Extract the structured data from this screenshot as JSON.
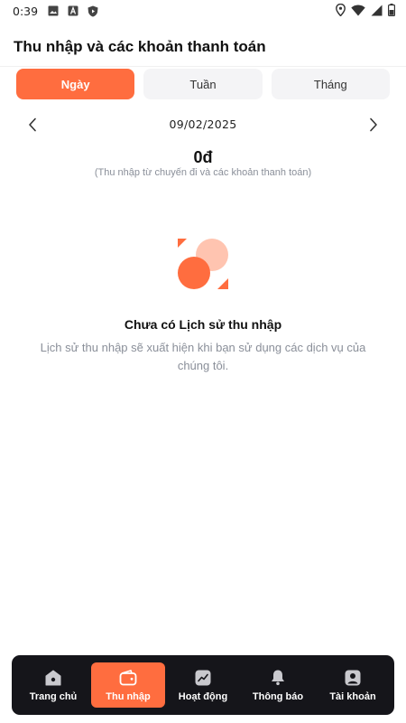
{
  "status_bar": {
    "time": "0:39"
  },
  "header": {
    "title": "Thu nhập và các khoản thanh toán"
  },
  "tabs": [
    {
      "label": "Ngày",
      "active": true
    },
    {
      "label": "Tuần",
      "active": false
    },
    {
      "label": "Tháng",
      "active": false
    }
  ],
  "date_nav": {
    "date": "09/02/2025"
  },
  "summary": {
    "amount": "0đ",
    "subtitle": "(Thu nhập từ chuyến đi và các khoản thanh toán)"
  },
  "empty_state": {
    "title": "Chưa có Lịch sử thu nhập",
    "description": "Lịch sử thu nhập sẽ xuất hiện khi bạn sử dụng các dịch vụ của chúng tôi."
  },
  "bottom_nav": {
    "items": [
      {
        "label": "Trang chủ",
        "icon": "home-icon",
        "active": false
      },
      {
        "label": "Thu nhập",
        "icon": "wallet-icon",
        "active": true
      },
      {
        "label": "Hoạt động",
        "icon": "activity-chart-icon",
        "active": false
      },
      {
        "label": "Thông báo",
        "icon": "bell-icon",
        "active": false
      },
      {
        "label": "Tài khoản",
        "icon": "account-icon",
        "active": false
      }
    ]
  },
  "colors": {
    "accent": "#ff6d3f",
    "accent_light": "#ffc4b0",
    "nav_background": "#15151a",
    "muted_text": "#8a8f99"
  }
}
